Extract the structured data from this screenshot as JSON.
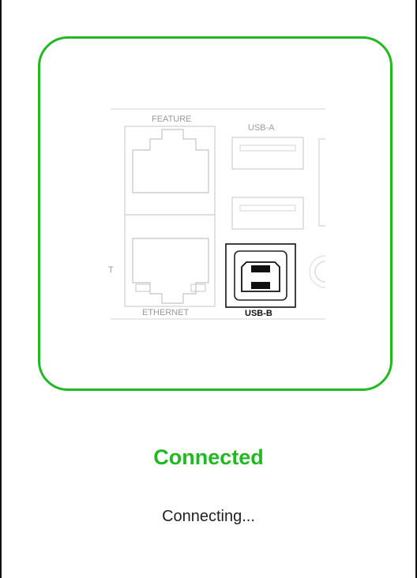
{
  "status": {
    "title": "Connected",
    "subtitle": "Connecting...",
    "accent_color": "#22b822"
  },
  "illustration": {
    "labels": {
      "feature": "FEATURE",
      "usb_a": "USB-A",
      "ethernet": "ETHERNET",
      "usb_b": "USB-B",
      "edge_letter": "T"
    },
    "highlighted_port": "USB-B",
    "icons": [
      "feature-port-icon",
      "usb-a-port-icon",
      "ethernet-port-icon",
      "usb-b-port-icon",
      "round-connector-icon"
    ]
  }
}
